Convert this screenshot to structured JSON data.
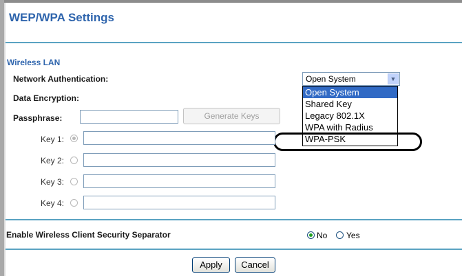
{
  "page": {
    "title": "WEP/WPA Settings"
  },
  "wireless_lan": {
    "section_label": "Wireless LAN",
    "network_auth_label": "Network Authentication:",
    "network_auth_value": "Open System",
    "network_auth_options": [
      "Open System",
      "Shared Key",
      "Legacy 802.1X",
      "WPA with Radius",
      "WPA-PSK"
    ],
    "data_encryption_label": "Data Encryption:",
    "passphrase_label": "Passphrase:",
    "passphrase_value": "",
    "generate_keys_label": "Generate Keys",
    "keys": [
      {
        "label": "Key 1:",
        "value": "",
        "selected": true
      },
      {
        "label": "Key 2:",
        "value": "",
        "selected": false
      },
      {
        "label": "Key 3:",
        "value": "",
        "selected": false
      },
      {
        "label": "Key 4:",
        "value": "",
        "selected": false
      }
    ]
  },
  "separator": {
    "label": "Enable Wireless Client Security Separator",
    "options": [
      "No",
      "Yes"
    ],
    "selected": "No"
  },
  "actions": {
    "apply": "Apply",
    "cancel": "Cancel"
  },
  "colors": {
    "heading": "#2f65ad",
    "rule": "#5aa3c2",
    "selection": "#316ac5"
  }
}
